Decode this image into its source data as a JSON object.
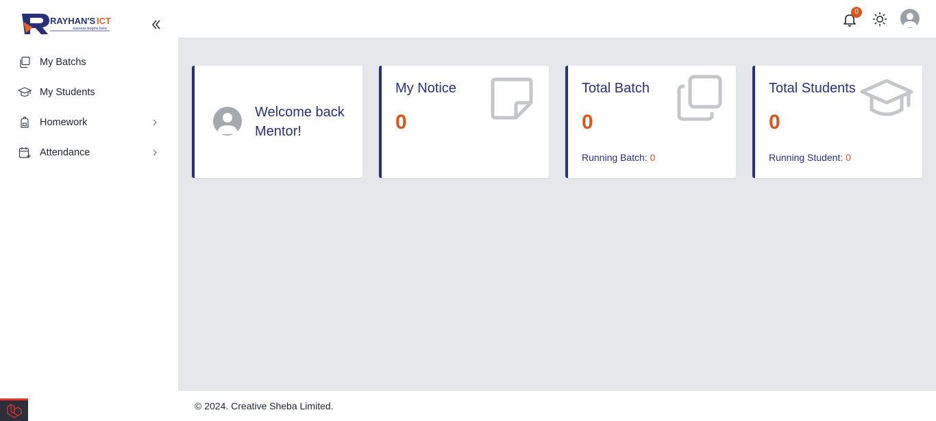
{
  "brand": {
    "name": "RAYHAN'S ICT",
    "tagline": "success begins here"
  },
  "sidebar": {
    "collapse_icon": "double-chevron-left-icon",
    "items": [
      {
        "label": "My Batchs",
        "icon": "copy-icon",
        "has_submenu": false
      },
      {
        "label": "My Students",
        "icon": "graduation-cap-icon",
        "has_submenu": false
      },
      {
        "label": "Homework",
        "icon": "backpack-icon",
        "has_submenu": true
      },
      {
        "label": "Attendance",
        "icon": "calendar-plus-icon",
        "has_submenu": true
      }
    ]
  },
  "header": {
    "notifications_count": "0",
    "icons": [
      "bell-icon",
      "sun-icon",
      "user-avatar"
    ]
  },
  "cards": {
    "welcome": {
      "text": "Welcome back Mentor!"
    },
    "notice": {
      "title": "My Notice",
      "count": "0",
      "icon": "sticky-note-icon"
    },
    "batch": {
      "title": "Total Batch",
      "count": "0",
      "sub_label": "Running Batch:",
      "sub_value": "0",
      "icon": "copy-icon"
    },
    "students": {
      "title": "Total Students",
      "count": "0",
      "sub_label": "Running Student:",
      "sub_value": "0",
      "icon": "graduation-cap-icon"
    }
  },
  "footer": {
    "text": "© 2024. Creative Sheba Limited."
  },
  "colors": {
    "primary": "#2a2f7a",
    "accent": "#d9561d",
    "background": "#e6e7eb",
    "surface": "#ffffff"
  }
}
